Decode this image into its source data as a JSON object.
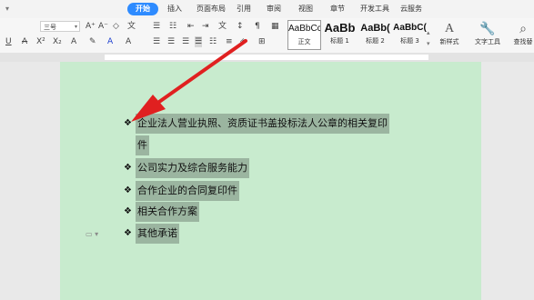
{
  "tabs": {
    "start": "开始",
    "insert": "插入",
    "layout": "页面布局",
    "references": "引用",
    "review": "审阅",
    "view": "视图",
    "section": "章节",
    "developer": "开发工具",
    "cloud": "云服务"
  },
  "ribbon": {
    "font_size": "三号",
    "styles": [
      {
        "preview": "AaBbCcI",
        "name": "正文"
      },
      {
        "preview": "AaBb",
        "name": "标题 1"
      },
      {
        "preview": "AaBb(",
        "name": "标题 2"
      },
      {
        "preview": "AaBbC(",
        "name": "标题 3"
      }
    ],
    "new_style": "新样式",
    "text_tools": "文字工具",
    "find_replace": "查找替"
  },
  "document": {
    "bullets": [
      "企业法人营业执照、资质证书盖投标法人公章的相关复印",
      "件",
      "公司实力及综合服务能力",
      "合作企业的合同复印件",
      "相关合作方案",
      "其他承诺"
    ]
  },
  "colors": {
    "accent": "#2e8bff",
    "page_bg": "#c8ebce",
    "highlight": "#9bb5a0",
    "arrow": "#e02020"
  }
}
